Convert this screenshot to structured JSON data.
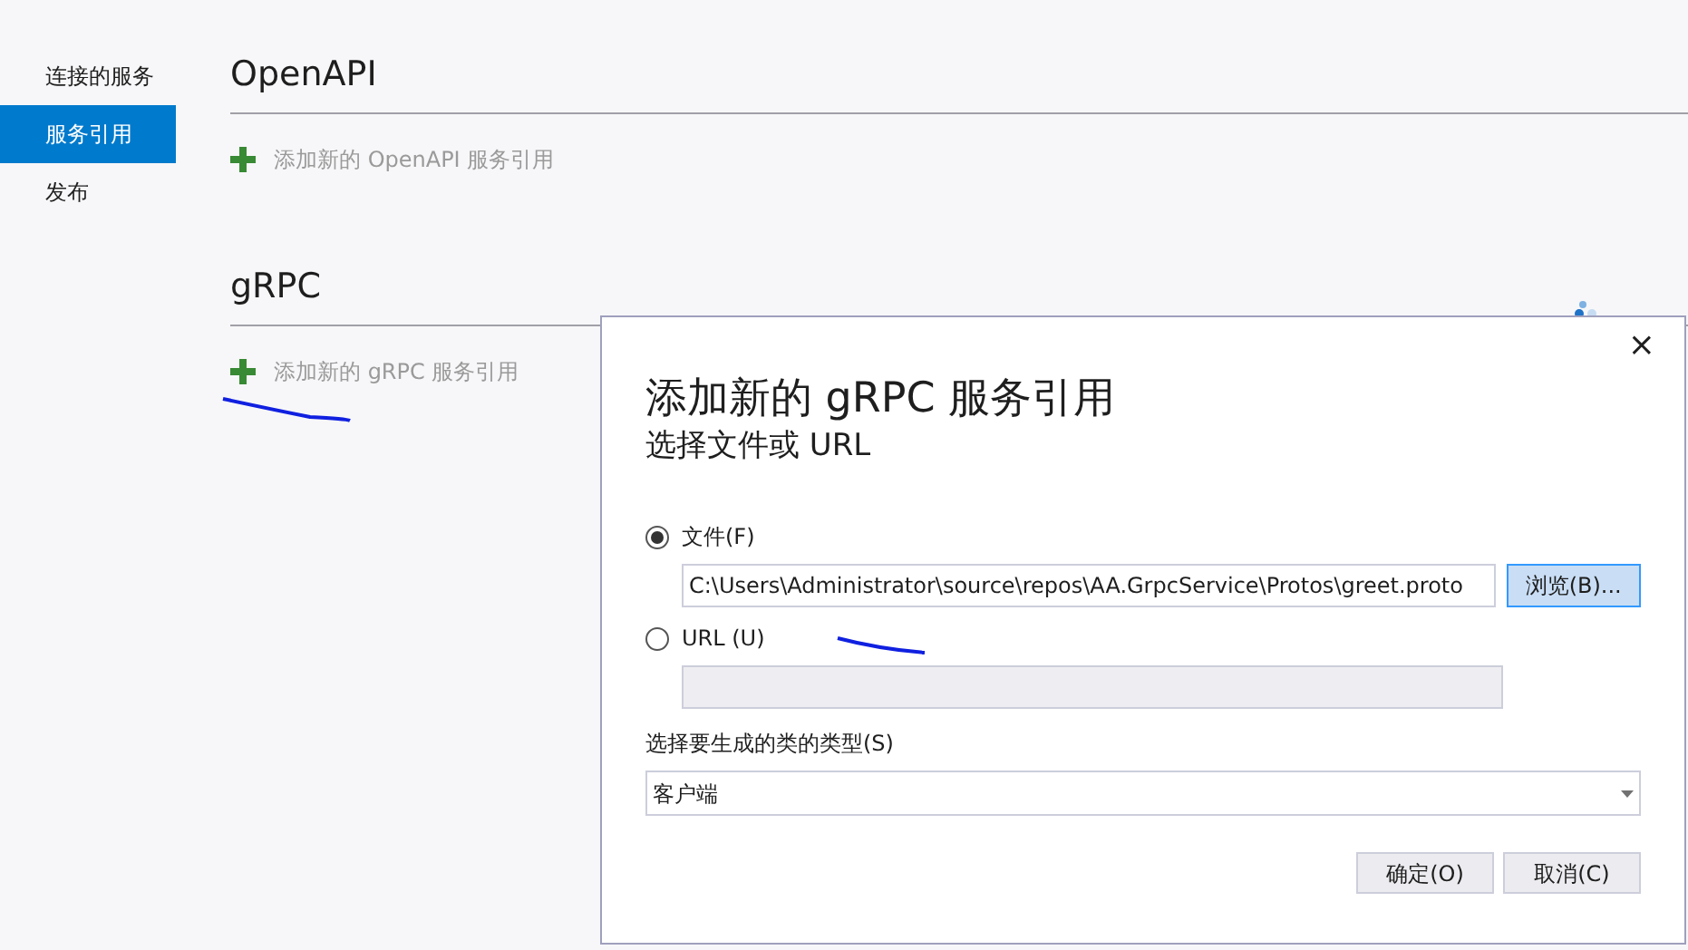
{
  "sidebar": {
    "items": [
      {
        "label": "连接的服务",
        "selected": false
      },
      {
        "label": "服务引用",
        "selected": true
      },
      {
        "label": "发布",
        "selected": false
      }
    ]
  },
  "sections": [
    {
      "title": "OpenAPI",
      "add_link": "添加新的 OpenAPI 服务引用"
    },
    {
      "title": "gRPC",
      "add_link": "添加新的 gRPC 服务引用",
      "busy": true
    }
  ],
  "dialog": {
    "close": "×",
    "title": "添加新的 gRPC 服务引用",
    "subtitle": "选择文件或 URL",
    "options": [
      {
        "label": "文件(F)",
        "selected": true,
        "value": "C:\\Users\\Administrator\\source\\repos\\AA.GrpcService\\Protos\\greet.proto",
        "disabled": false,
        "button": "浏览(B)..."
      },
      {
        "label": "URL (U)",
        "selected": false,
        "disabled": true
      }
    ],
    "type_label": "选择要生成的类的类型(S)",
    "type_value": "客户端",
    "buttons": [
      "确定(O)",
      "取消(C)"
    ]
  }
}
